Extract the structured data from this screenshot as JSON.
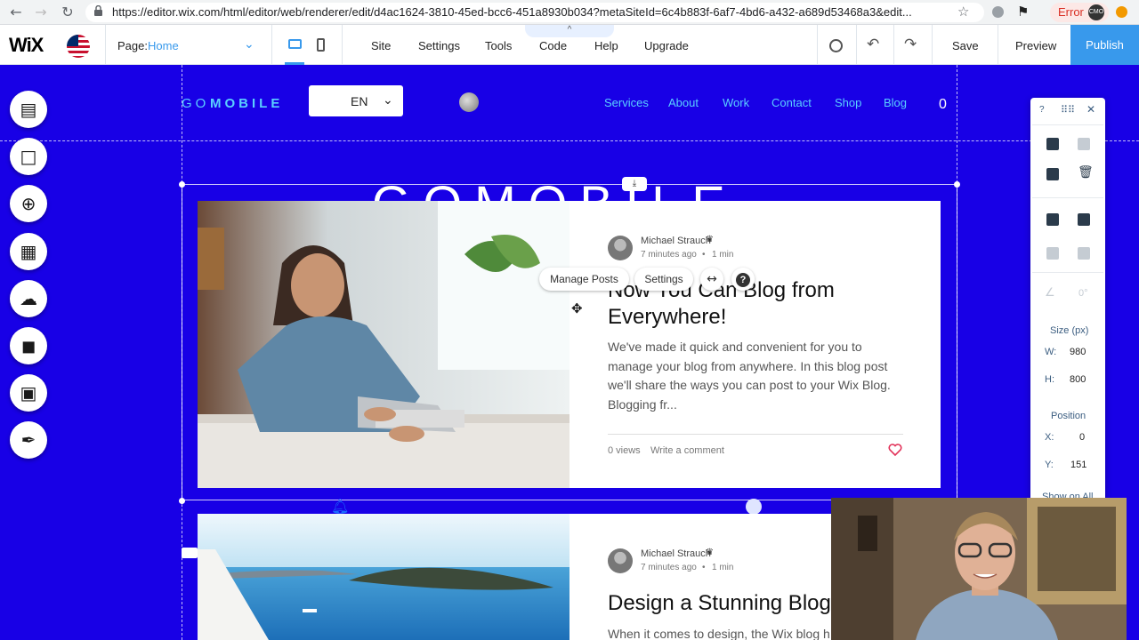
{
  "browser": {
    "url": "https://editor.wix.com/html/editor/web/renderer/edit/d4ac1624-3810-45ed-bcc6-451a8930b034?metaSiteId=6c4b883f-6af7-4bd6-a432-a689d53468a3&edit...",
    "error_label": "Error",
    "profile_initials": "CMO",
    "icons": [
      "back-icon",
      "forward-icon",
      "reload-icon",
      "lock-icon",
      "star-icon"
    ]
  },
  "topbar": {
    "logo": "WiX",
    "page_label": "Page:",
    "page_value": "Home",
    "menu": [
      "Site",
      "Settings",
      "Tools",
      "Code",
      "Help",
      "Upgrade"
    ],
    "code_tab": "^",
    "save": "Save",
    "preview": "Preview",
    "publish": "Publish",
    "accent_color": "#3899ec"
  },
  "left_tools": [
    "pages-icon",
    "background-icon",
    "add-icon",
    "app-market-icon",
    "upload-icon",
    "store-icon",
    "bookings-icon",
    "blog-icon"
  ],
  "site": {
    "logo_prefix": "GO",
    "logo_suffix": "MOBILE",
    "language": "EN",
    "nav": [
      "Services",
      "About",
      "Work",
      "Contact",
      "Shop",
      "Blog"
    ],
    "cart_count": "0",
    "hero_title": "GOMOBILE",
    "background_color": "#1800e6",
    "accent_color": "#5ad0ff"
  },
  "toolbar": {
    "manage_posts": "Manage Posts",
    "settings": "Settings",
    "help": "?"
  },
  "posts": [
    {
      "author": "Michael Strauch",
      "time": "7 minutes ago",
      "read_time": "1 min",
      "title": "Now You Can Blog from Everywhere!",
      "excerpt": "We've made it quick and convenient for you to manage your blog from anywhere. In this blog post we'll share the ways you can post to your Wix Blog. Blogging fr...",
      "views": "0 views",
      "comment": "Write a comment"
    },
    {
      "author": "Michael Strauch",
      "time": "7 minutes ago",
      "read_time": "1 min",
      "title": "Design a Stunning Blog",
      "excerpt": "When it comes to design, the Wix blog has"
    }
  ],
  "panel": {
    "help": "?",
    "size_label": "Size (px)",
    "w_label": "W:",
    "w_value": "980",
    "h_label": "H:",
    "h_value": "800",
    "position_label": "Position",
    "x_label": "X:",
    "x_value": "0",
    "y_label": "Y:",
    "y_value": "151",
    "rotation": "0°",
    "show_on_all": "Show on All"
  }
}
